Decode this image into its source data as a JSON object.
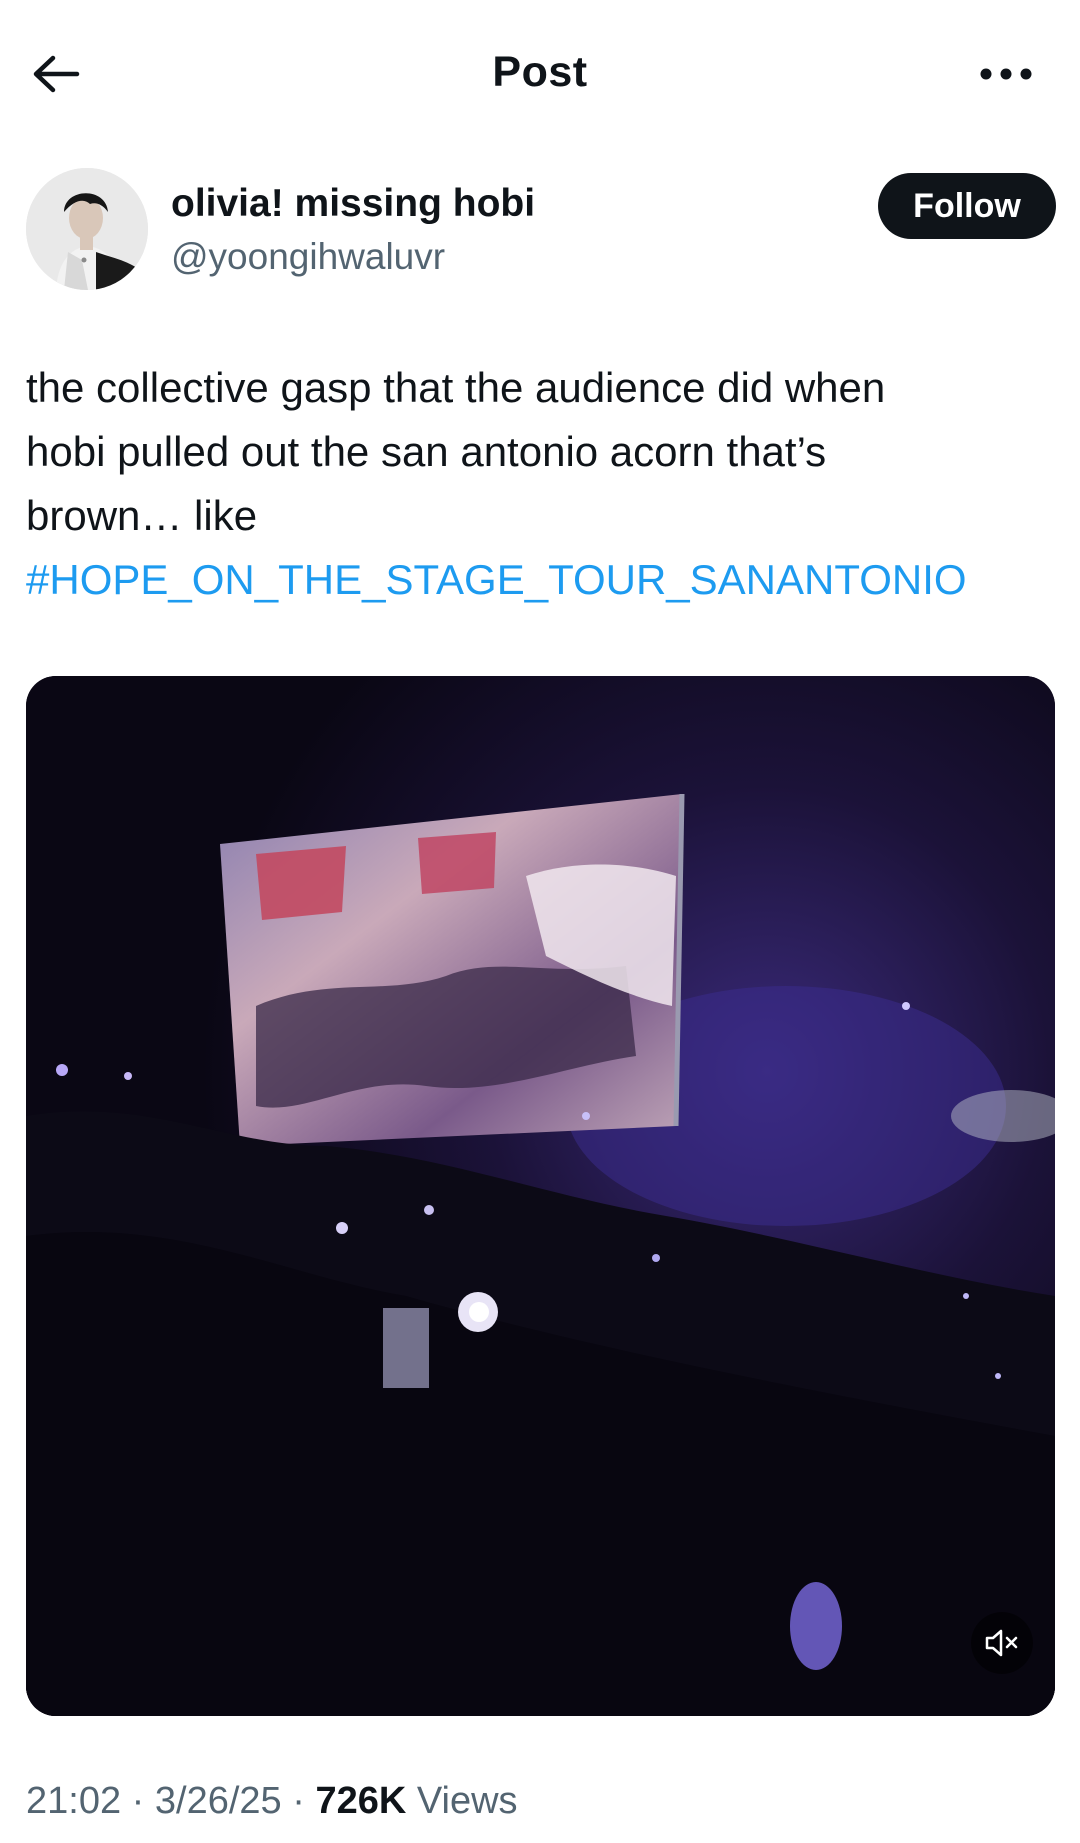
{
  "header": {
    "title": "Post",
    "back_icon": "arrow-left-icon",
    "more_icon": "more-horizontal-icon"
  },
  "author": {
    "display_name": "olivia! missing hobi",
    "handle": "@yoongihwaluvr",
    "follow_label": "Follow"
  },
  "post": {
    "text_lines": [
      "the collective gasp that the audience did when",
      "hobi pulled out the san antonio acorn that’s",
      "brown… like"
    ],
    "hashtag": "#HOPE_ON_THE_STAGE_TOUR_SANANTONIO",
    "media": {
      "type": "video",
      "muted": true,
      "mute_icon": "volume-muted-icon"
    }
  },
  "meta": {
    "time": "21:02",
    "separator": "·",
    "date": "3/26/25",
    "views_count": "726K",
    "views_label": "Views"
  },
  "colors": {
    "text": "#0f1419",
    "secondary": "#536471",
    "link": "#1d9bf0",
    "follow_bg": "#0f1419"
  }
}
